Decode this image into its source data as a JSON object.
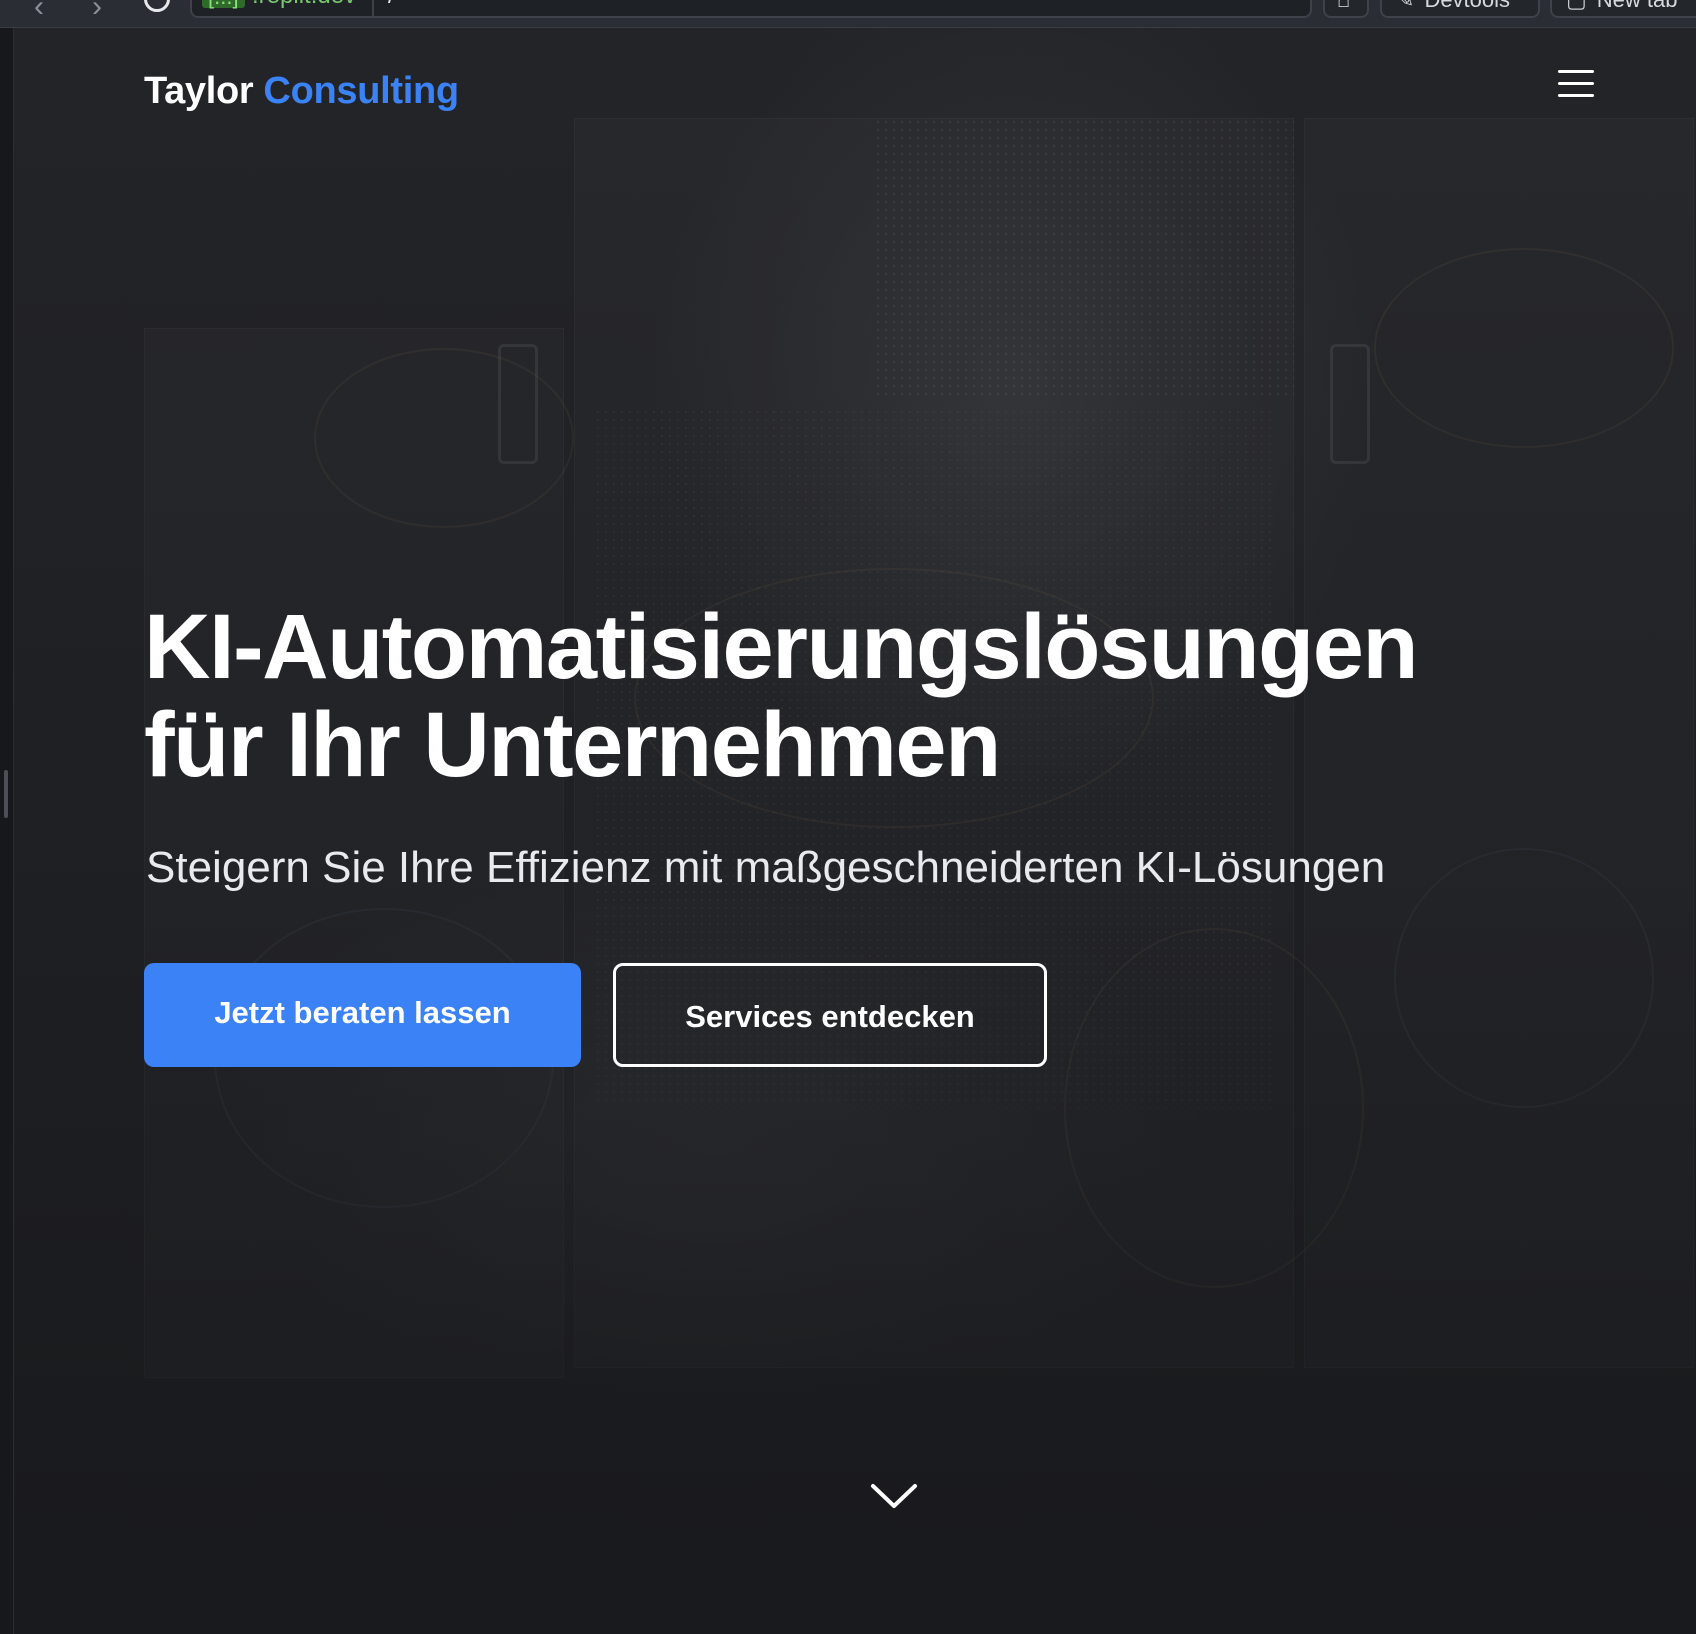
{
  "browser": {
    "url_host_chip": "[...]",
    "url_host_rest": ".replit.dev",
    "url_path": "/",
    "devtools_label": "Devtools",
    "new_tab_label": "New tab"
  },
  "header": {
    "logo_part1": "Taylor",
    "logo_part2": "Consulting",
    "menu_icon": "hamburger-icon"
  },
  "hero": {
    "title_line1": "KI-Automatisierungslösungen",
    "title_line2": "für Ihr Unternehmen",
    "subtitle": "Steigern Sie Ihre Effizienz mit maßgeschneiderten KI-Lösungen",
    "primary_button": "Jetzt beraten lassen",
    "secondary_button": "Services entdecken",
    "scroll_icon": "chevron-down-icon"
  },
  "colors": {
    "accent": "#3b82f6",
    "background": "#222327",
    "text": "#ffffff"
  }
}
